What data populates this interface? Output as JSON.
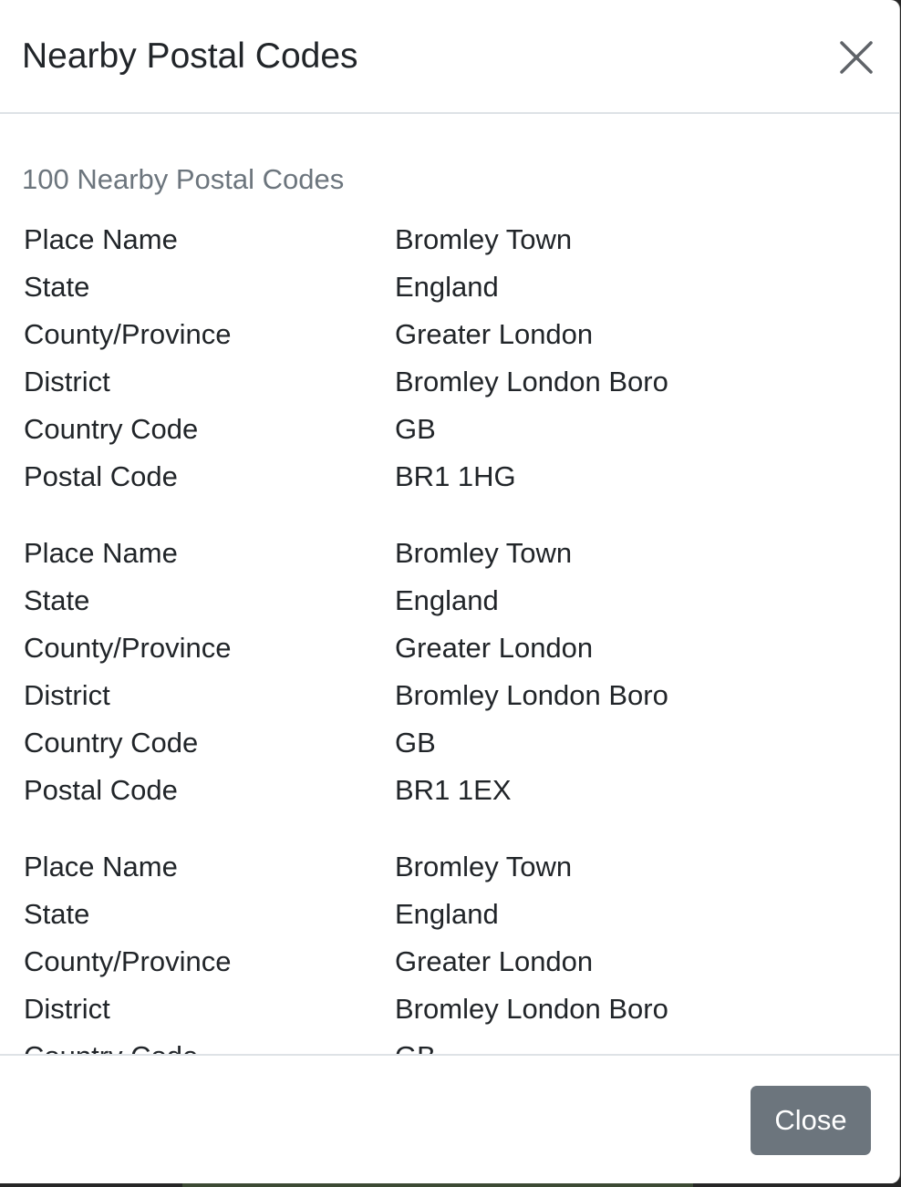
{
  "modal": {
    "title": "Nearby Postal Codes",
    "summary": "100 Nearby Postal Codes",
    "close_button_label": "Close"
  },
  "field_labels": {
    "place_name": "Place Name",
    "state": "State",
    "county": "County/Province",
    "district": "District",
    "country_code": "Country Code",
    "postal_code": "Postal Code"
  },
  "records": [
    {
      "place_name": "Bromley Town",
      "state": "England",
      "county": "Greater London",
      "district": "Bromley London Boro",
      "country_code": "GB",
      "postal_code": "BR1 1HG"
    },
    {
      "place_name": "Bromley Town",
      "state": "England",
      "county": "Greater London",
      "district": "Bromley London Boro",
      "country_code": "GB",
      "postal_code": "BR1 1EX"
    },
    {
      "place_name": "Bromley Town",
      "state": "England",
      "county": "Greater London",
      "district": "Bromley London Boro",
      "country_code": "GB",
      "postal_code": ""
    }
  ],
  "icons": {
    "close": "close-icon"
  },
  "colors": {
    "title_text": "#212529",
    "muted_text": "#6c757d",
    "divider": "#dee2e6",
    "close_button_bg": "#6c757d",
    "close_button_text": "#ffffff"
  }
}
